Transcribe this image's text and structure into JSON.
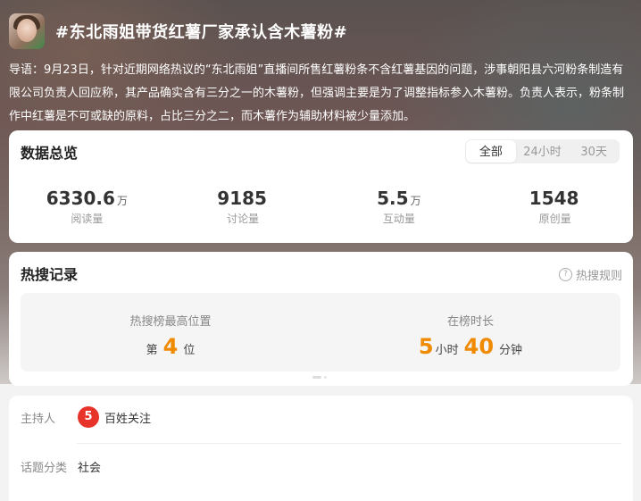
{
  "topic": {
    "title": "#东北雨姐带货红薯厂家承认含木薯粉#",
    "intro": "导语：9月23日，针对近期网络热议的“东北雨姐”直播间所售红薯粉条不含红薯基因的问题，涉事朝阳县六河粉条制造有限公司负责人回应称，其产品确实含有三分之一的木薯粉，但强调主要是为了调整指标参入木薯粉。负责人表示，粉条制作中红薯是不可或缺的原料，占比三分之二，而木薯作为辅助材料被少量添加。"
  },
  "stats": {
    "title": "数据总览",
    "tabs": [
      "全部",
      "24小时",
      "30天"
    ],
    "items": [
      {
        "value": "6330.6",
        "unit": "万",
        "label": "阅读量"
      },
      {
        "value": "9185",
        "unit": "",
        "label": "讨论量"
      },
      {
        "value": "5.5",
        "unit": "万",
        "label": "互动量"
      },
      {
        "value": "1548",
        "unit": "",
        "label": "原创量"
      }
    ]
  },
  "hot": {
    "title": "热搜记录",
    "rule_link": "热搜规则",
    "rule_icon": "?",
    "peak_label": "热搜榜最高位置",
    "peak_prefix": "第",
    "peak_value": "4",
    "peak_suffix": "位",
    "duration_label": "在榜时长",
    "hours": "5",
    "hours_unit": "小时",
    "minutes": "40",
    "minutes_unit": "分钟"
  },
  "info": {
    "host_label": "主持人",
    "host_logo": "5",
    "host_name": "百姓关注",
    "category_label": "话题分类",
    "category": "社会"
  }
}
